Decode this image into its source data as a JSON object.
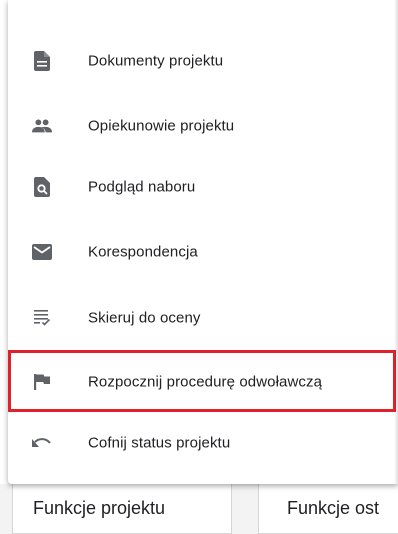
{
  "menu": {
    "items": [
      {
        "label": "Dokumenty projektu",
        "icon": "document-icon"
      },
      {
        "label": "Opiekunowie projektu",
        "icon": "people-icon"
      },
      {
        "label": "Podgląd naboru",
        "icon": "preview-search-icon"
      },
      {
        "label": "Korespondencja",
        "icon": "mail-icon"
      },
      {
        "label": "Skieruj do oceny",
        "icon": "checklist-icon"
      },
      {
        "label": "Rozpocznij procedurę odwoławczą",
        "icon": "flag-icon"
      },
      {
        "label": "Cofnij status projektu",
        "icon": "undo-icon"
      }
    ],
    "highlighted_item": "Rozpocznij procedurę odwoławczą",
    "highlight_color": "#e0202a",
    "icon_color": "#5f6368"
  },
  "tabs": [
    {
      "label": "Funkcje projektu"
    },
    {
      "label": "Funkcje ost"
    }
  ]
}
